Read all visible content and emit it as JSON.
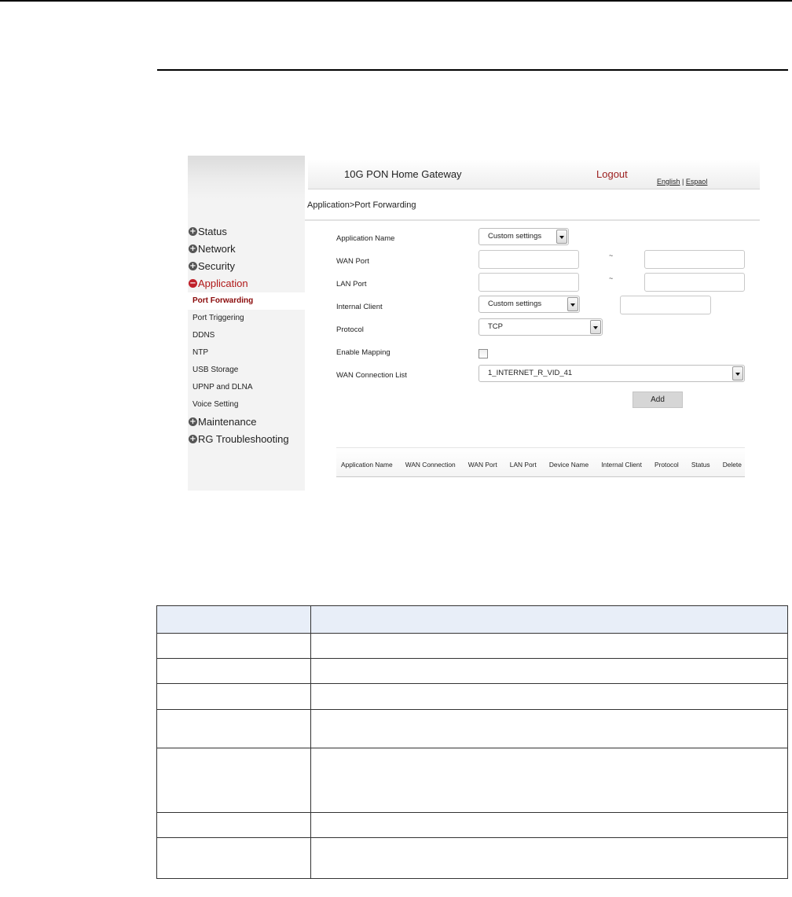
{
  "gateway": {
    "title": "10G PON Home Gateway",
    "logout": "Logout",
    "lang_english": "English",
    "lang_separator": "|",
    "lang_espanol": "Espaol"
  },
  "breadcrumb": "Application>Port Forwarding",
  "sidebar": {
    "items": [
      {
        "label": "Status",
        "type": "main"
      },
      {
        "label": "Network",
        "type": "main"
      },
      {
        "label": "Security",
        "type": "main"
      },
      {
        "label": "Application",
        "type": "main",
        "active": true
      },
      {
        "label": "Port Forwarding",
        "type": "sub",
        "active": true
      },
      {
        "label": "Port Triggering",
        "type": "sub"
      },
      {
        "label": "DDNS",
        "type": "sub"
      },
      {
        "label": "NTP",
        "type": "sub"
      },
      {
        "label": "USB Storage",
        "type": "sub"
      },
      {
        "label": "UPNP and DLNA",
        "type": "sub"
      },
      {
        "label": "Voice Setting",
        "type": "sub"
      },
      {
        "label": "Maintenance",
        "type": "main"
      },
      {
        "label": "RG Troubleshooting",
        "type": "main"
      }
    ]
  },
  "form": {
    "application_name_label": "Application Name",
    "application_name_value": "Custom settings",
    "wan_port_label": "WAN Port",
    "lan_port_label": "LAN Port",
    "range_sep": "~",
    "internal_client_label": "Internal Client",
    "internal_client_value": "Custom settings",
    "protocol_label": "Protocol",
    "protocol_value": "TCP",
    "enable_mapping_label": "Enable Mapping",
    "enable_mapping_checked": false,
    "wan_connection_label": "WAN Connection List",
    "wan_connection_value": "1_INTERNET_R_VID_41",
    "add_button": "Add"
  },
  "rules_table": {
    "columns": [
      "Application Name",
      "WAN Connection",
      "WAN Port",
      "LAN Port",
      "Device Name",
      "Internal Client",
      "Protocol",
      "Status",
      "Delete"
    ]
  },
  "colors": {
    "accent_red": "#b01818",
    "doc_table_header": "#e8eef8"
  }
}
